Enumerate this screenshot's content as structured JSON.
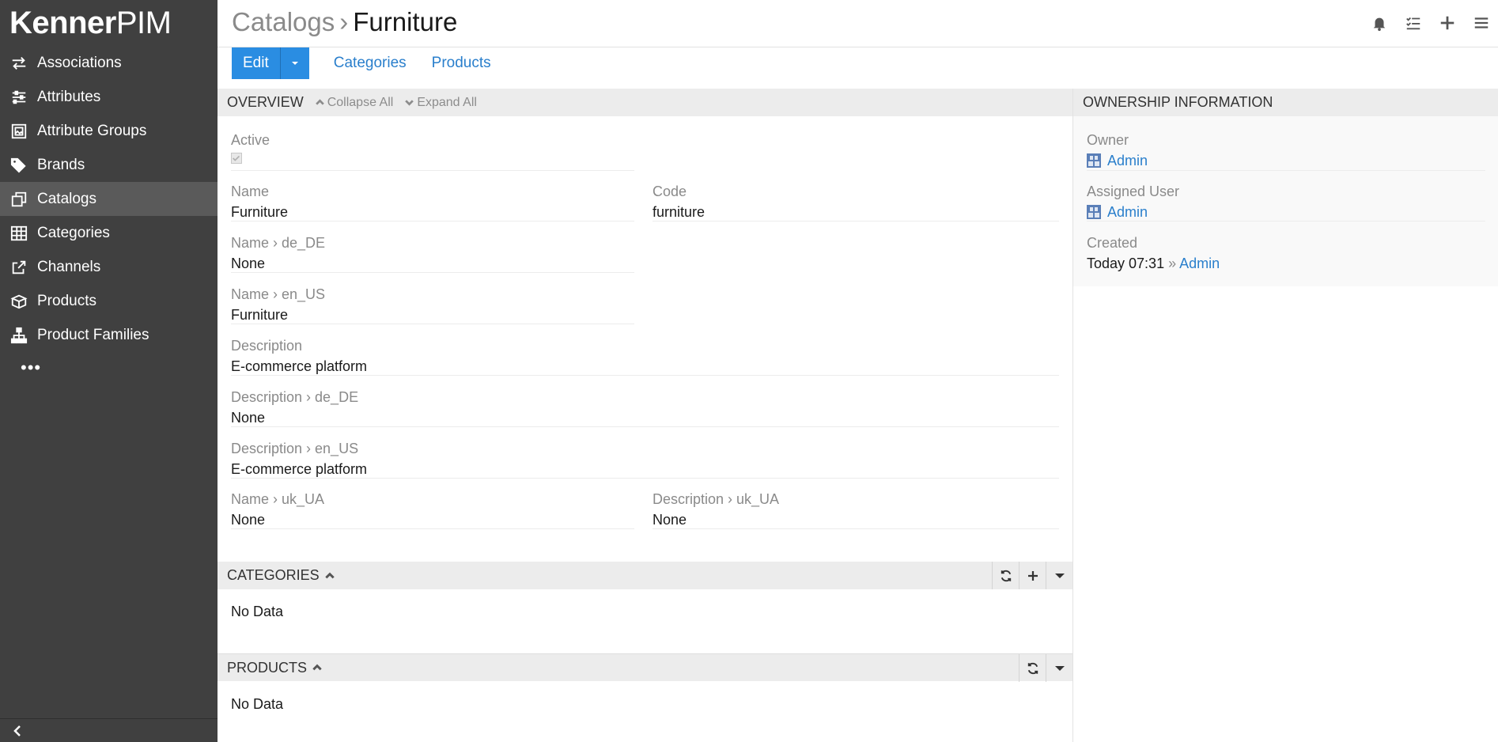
{
  "app": {
    "logo_bold": "Kenner",
    "logo_light": "PIM"
  },
  "sidebar": {
    "items": [
      {
        "label": "Associations",
        "icon": "arrows-exchange-icon"
      },
      {
        "label": "Attributes",
        "icon": "sliders-icon"
      },
      {
        "label": "Attribute Groups",
        "icon": "image-box-icon"
      },
      {
        "label": "Brands",
        "icon": "tags-icon"
      },
      {
        "label": "Catalogs",
        "icon": "clone-icon",
        "active": true
      },
      {
        "label": "Categories",
        "icon": "grid-icon"
      },
      {
        "label": "Channels",
        "icon": "share-square-icon"
      },
      {
        "label": "Products",
        "icon": "box-open-icon"
      },
      {
        "label": "Product Families",
        "icon": "sitemap-icon"
      }
    ],
    "more_label": "•••"
  },
  "header": {
    "breadcrumb_parent": "Catalogs",
    "breadcrumb_sep": "›",
    "breadcrumb_current": "Furniture"
  },
  "toolbar": {
    "edit_label": "Edit",
    "links": [
      "Categories",
      "Products"
    ]
  },
  "overview": {
    "title": "OVERVIEW",
    "collapse_all": "Collapse All",
    "expand_all": "Expand All",
    "fields": {
      "active_label": "Active",
      "name_label": "Name",
      "name_value": "Furniture",
      "code_label": "Code",
      "code_value": "furniture",
      "name_de_label": "Name › de_DE",
      "name_de_value": "None",
      "name_en_label": "Name › en_US",
      "name_en_value": "Furniture",
      "desc_label": "Description",
      "desc_value": "E-commerce platform",
      "desc_de_label": "Description › de_DE",
      "desc_de_value": "None",
      "desc_en_label": "Description › en_US",
      "desc_en_value": "E-commerce platform",
      "name_uk_label": "Name › uk_UA",
      "name_uk_value": "None",
      "desc_uk_label": "Description › uk_UA",
      "desc_uk_value": "None"
    }
  },
  "categories_panel": {
    "title": "CATEGORIES",
    "empty": "No Data"
  },
  "products_panel": {
    "title": "PRODUCTS",
    "empty": "No Data"
  },
  "ownership": {
    "title": "OWNERSHIP INFORMATION",
    "owner_label": "Owner",
    "owner_value": "Admin",
    "assigned_label": "Assigned User",
    "assigned_value": "Admin",
    "created_label": "Created",
    "created_value": "Today 07:31",
    "created_sep": "»",
    "created_by": "Admin"
  },
  "colors": {
    "sidebar_bg": "#404040",
    "sidebar_active": "#5a5a5a",
    "accent": "#2a8de2",
    "link": "#2a7fcc"
  }
}
